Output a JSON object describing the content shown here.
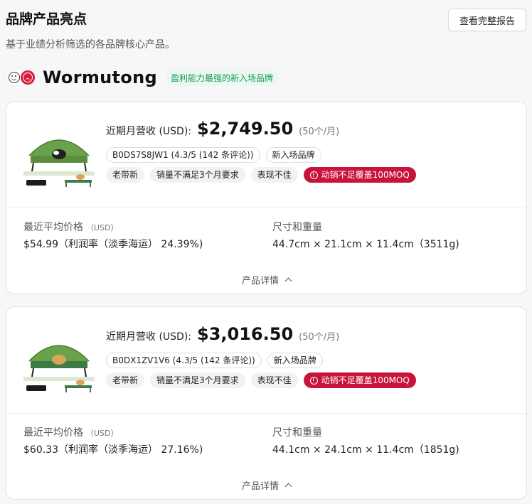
{
  "page": {
    "title": "品牌产品亮点",
    "subtitle": "基于业绩分析筛选的各品牌核心产品。",
    "report_button": "查看完整报告"
  },
  "brand": {
    "name": "Wormutong",
    "tag": "盈利能力最强的新入场品牌",
    "logo_icons": [
      "neutral-face-icon",
      "sad-face-icon"
    ]
  },
  "products": [
    {
      "revenue_label": "近期月营收 (USD):",
      "revenue_value": "$2,749.50",
      "units": "(50个/月)",
      "asin": "B0DS7S8JW1 (4.3/5 (142 条评论))",
      "brand_badge": "新入场品牌",
      "tags": [
        "老带新",
        "销量不满足3个月要求",
        "表现不佳"
      ],
      "alert": "动销不足覆盖100MOQ",
      "price_label": "最近平均价格",
      "price_unit": "（USD）",
      "price_value": "$54.99（利润率（淡季海运） 24.39%)",
      "size_label": "尺寸和重量",
      "size_value": "44.7cm × 21.1cm × 11.4cm（3511g)",
      "details_label": "产品详情"
    },
    {
      "revenue_label": "近期月营收 (USD):",
      "revenue_value": "$3,016.50",
      "units": "(50个/月)",
      "asin": "B0DX1ZV1V6 (4.3/5 (142 条评论))",
      "brand_badge": "新入场品牌",
      "tags": [
        "老带新",
        "销量不满足3个月要求",
        "表现不佳"
      ],
      "alert": "动销不足覆盖100MOQ",
      "price_label": "最近平均价格",
      "price_unit": "（USD）",
      "price_value": "$60.33（利润率（淡季海运） 27.16%)",
      "size_label": "尺寸和重量",
      "size_value": "44.1cm × 24.1cm × 11.4cm（1851g)",
      "details_label": "产品详情"
    }
  ],
  "colors": {
    "alert_red": "#c8143b",
    "brand_green": "#1a9a5c",
    "tent_green": "#6aa24a"
  }
}
